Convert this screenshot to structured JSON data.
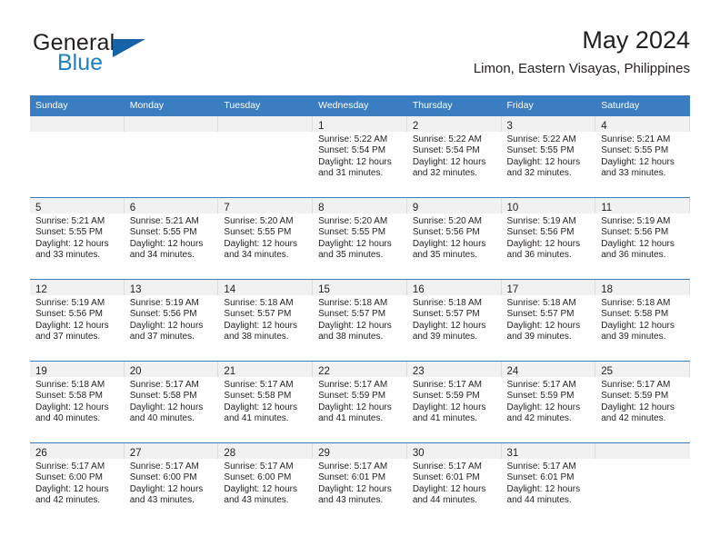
{
  "brand": {
    "name_top": "General",
    "name_bottom": "Blue",
    "flag_icon": "triangle-flag-icon",
    "accent_color": "#1763a8",
    "text_color": "#1f7fc4"
  },
  "header": {
    "title": "May 2024",
    "subtitle": "Limon, Eastern Visayas, Philippines"
  },
  "theme": {
    "header_row_bg": "#3a7dc0",
    "daynum_band_bg": "#f1f1f1",
    "row_divider": "#3a7dc0",
    "text": "#231f20"
  },
  "weekday_headers": [
    "Sunday",
    "Monday",
    "Tuesday",
    "Wednesday",
    "Thursday",
    "Friday",
    "Saturday"
  ],
  "weeks": [
    [
      {
        "empty": true
      },
      {
        "empty": true
      },
      {
        "empty": true
      },
      {
        "day": "1",
        "sunrise": "Sunrise: 5:22 AM",
        "sunset": "Sunset: 5:54 PM",
        "daylight_1": "Daylight: 12 hours",
        "daylight_2": "and 31 minutes."
      },
      {
        "day": "2",
        "sunrise": "Sunrise: 5:22 AM",
        "sunset": "Sunset: 5:54 PM",
        "daylight_1": "Daylight: 12 hours",
        "daylight_2": "and 32 minutes."
      },
      {
        "day": "3",
        "sunrise": "Sunrise: 5:22 AM",
        "sunset": "Sunset: 5:55 PM",
        "daylight_1": "Daylight: 12 hours",
        "daylight_2": "and 32 minutes."
      },
      {
        "day": "4",
        "sunrise": "Sunrise: 5:21 AM",
        "sunset": "Sunset: 5:55 PM",
        "daylight_1": "Daylight: 12 hours",
        "daylight_2": "and 33 minutes."
      }
    ],
    [
      {
        "day": "5",
        "sunrise": "Sunrise: 5:21 AM",
        "sunset": "Sunset: 5:55 PM",
        "daylight_1": "Daylight: 12 hours",
        "daylight_2": "and 33 minutes."
      },
      {
        "day": "6",
        "sunrise": "Sunrise: 5:21 AM",
        "sunset": "Sunset: 5:55 PM",
        "daylight_1": "Daylight: 12 hours",
        "daylight_2": "and 34 minutes."
      },
      {
        "day": "7",
        "sunrise": "Sunrise: 5:20 AM",
        "sunset": "Sunset: 5:55 PM",
        "daylight_1": "Daylight: 12 hours",
        "daylight_2": "and 34 minutes."
      },
      {
        "day": "8",
        "sunrise": "Sunrise: 5:20 AM",
        "sunset": "Sunset: 5:55 PM",
        "daylight_1": "Daylight: 12 hours",
        "daylight_2": "and 35 minutes."
      },
      {
        "day": "9",
        "sunrise": "Sunrise: 5:20 AM",
        "sunset": "Sunset: 5:56 PM",
        "daylight_1": "Daylight: 12 hours",
        "daylight_2": "and 35 minutes."
      },
      {
        "day": "10",
        "sunrise": "Sunrise: 5:19 AM",
        "sunset": "Sunset: 5:56 PM",
        "daylight_1": "Daylight: 12 hours",
        "daylight_2": "and 36 minutes."
      },
      {
        "day": "11",
        "sunrise": "Sunrise: 5:19 AM",
        "sunset": "Sunset: 5:56 PM",
        "daylight_1": "Daylight: 12 hours",
        "daylight_2": "and 36 minutes."
      }
    ],
    [
      {
        "day": "12",
        "sunrise": "Sunrise: 5:19 AM",
        "sunset": "Sunset: 5:56 PM",
        "daylight_1": "Daylight: 12 hours",
        "daylight_2": "and 37 minutes."
      },
      {
        "day": "13",
        "sunrise": "Sunrise: 5:19 AM",
        "sunset": "Sunset: 5:56 PM",
        "daylight_1": "Daylight: 12 hours",
        "daylight_2": "and 37 minutes."
      },
      {
        "day": "14",
        "sunrise": "Sunrise: 5:18 AM",
        "sunset": "Sunset: 5:57 PM",
        "daylight_1": "Daylight: 12 hours",
        "daylight_2": "and 38 minutes."
      },
      {
        "day": "15",
        "sunrise": "Sunrise: 5:18 AM",
        "sunset": "Sunset: 5:57 PM",
        "daylight_1": "Daylight: 12 hours",
        "daylight_2": "and 38 minutes."
      },
      {
        "day": "16",
        "sunrise": "Sunrise: 5:18 AM",
        "sunset": "Sunset: 5:57 PM",
        "daylight_1": "Daylight: 12 hours",
        "daylight_2": "and 39 minutes."
      },
      {
        "day": "17",
        "sunrise": "Sunrise: 5:18 AM",
        "sunset": "Sunset: 5:57 PM",
        "daylight_1": "Daylight: 12 hours",
        "daylight_2": "and 39 minutes."
      },
      {
        "day": "18",
        "sunrise": "Sunrise: 5:18 AM",
        "sunset": "Sunset: 5:58 PM",
        "daylight_1": "Daylight: 12 hours",
        "daylight_2": "and 39 minutes."
      }
    ],
    [
      {
        "day": "19",
        "sunrise": "Sunrise: 5:18 AM",
        "sunset": "Sunset: 5:58 PM",
        "daylight_1": "Daylight: 12 hours",
        "daylight_2": "and 40 minutes."
      },
      {
        "day": "20",
        "sunrise": "Sunrise: 5:17 AM",
        "sunset": "Sunset: 5:58 PM",
        "daylight_1": "Daylight: 12 hours",
        "daylight_2": "and 40 minutes."
      },
      {
        "day": "21",
        "sunrise": "Sunrise: 5:17 AM",
        "sunset": "Sunset: 5:58 PM",
        "daylight_1": "Daylight: 12 hours",
        "daylight_2": "and 41 minutes."
      },
      {
        "day": "22",
        "sunrise": "Sunrise: 5:17 AM",
        "sunset": "Sunset: 5:59 PM",
        "daylight_1": "Daylight: 12 hours",
        "daylight_2": "and 41 minutes."
      },
      {
        "day": "23",
        "sunrise": "Sunrise: 5:17 AM",
        "sunset": "Sunset: 5:59 PM",
        "daylight_1": "Daylight: 12 hours",
        "daylight_2": "and 41 minutes."
      },
      {
        "day": "24",
        "sunrise": "Sunrise: 5:17 AM",
        "sunset": "Sunset: 5:59 PM",
        "daylight_1": "Daylight: 12 hours",
        "daylight_2": "and 42 minutes."
      },
      {
        "day": "25",
        "sunrise": "Sunrise: 5:17 AM",
        "sunset": "Sunset: 5:59 PM",
        "daylight_1": "Daylight: 12 hours",
        "daylight_2": "and 42 minutes."
      }
    ],
    [
      {
        "day": "26",
        "sunrise": "Sunrise: 5:17 AM",
        "sunset": "Sunset: 6:00 PM",
        "daylight_1": "Daylight: 12 hours",
        "daylight_2": "and 42 minutes."
      },
      {
        "day": "27",
        "sunrise": "Sunrise: 5:17 AM",
        "sunset": "Sunset: 6:00 PM",
        "daylight_1": "Daylight: 12 hours",
        "daylight_2": "and 43 minutes."
      },
      {
        "day": "28",
        "sunrise": "Sunrise: 5:17 AM",
        "sunset": "Sunset: 6:00 PM",
        "daylight_1": "Daylight: 12 hours",
        "daylight_2": "and 43 minutes."
      },
      {
        "day": "29",
        "sunrise": "Sunrise: 5:17 AM",
        "sunset": "Sunset: 6:01 PM",
        "daylight_1": "Daylight: 12 hours",
        "daylight_2": "and 43 minutes."
      },
      {
        "day": "30",
        "sunrise": "Sunrise: 5:17 AM",
        "sunset": "Sunset: 6:01 PM",
        "daylight_1": "Daylight: 12 hours",
        "daylight_2": "and 44 minutes."
      },
      {
        "day": "31",
        "sunrise": "Sunrise: 5:17 AM",
        "sunset": "Sunset: 6:01 PM",
        "daylight_1": "Daylight: 12 hours",
        "daylight_2": "and 44 minutes."
      },
      {
        "empty": true
      }
    ]
  ]
}
